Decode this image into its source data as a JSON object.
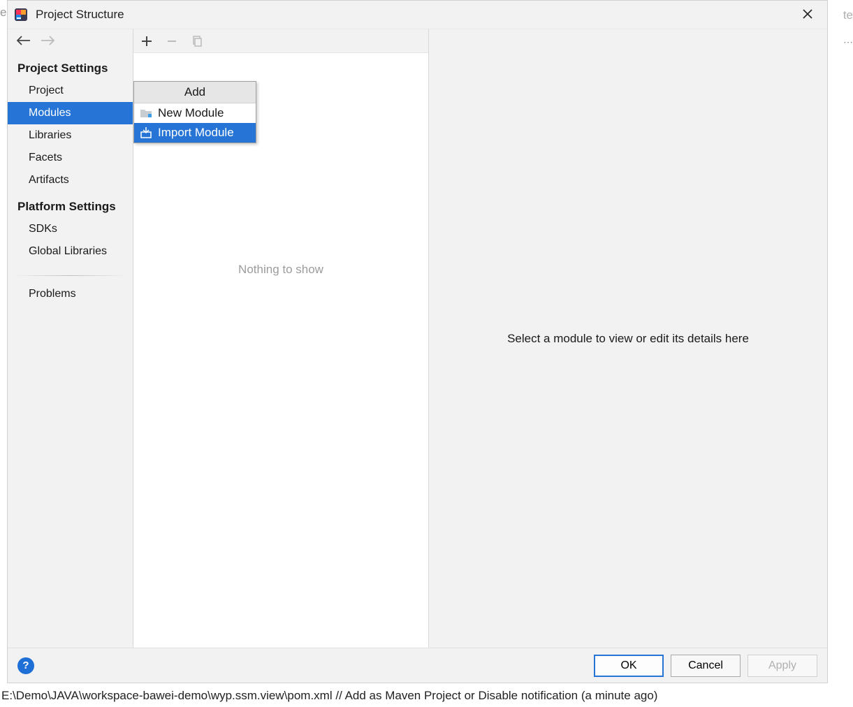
{
  "dialog": {
    "title": "Project Structure"
  },
  "sidebar": {
    "sections": [
      {
        "header": "Project Settings",
        "items": [
          "Project",
          "Modules",
          "Libraries",
          "Facets",
          "Artifacts"
        ],
        "selected_index": 1
      },
      {
        "header": "Platform Settings",
        "items": [
          "SDKs",
          "Global Libraries"
        ]
      }
    ],
    "problems_label": "Problems"
  },
  "middle": {
    "empty_text": "Nothing to show"
  },
  "right": {
    "hint": "Select a module to view or edit its details here"
  },
  "popup": {
    "title": "Add",
    "items": [
      {
        "label": "New Module",
        "icon": "folder-icon"
      },
      {
        "label": "Import Module",
        "icon": "import-icon",
        "highlighted": true
      }
    ]
  },
  "footer": {
    "ok": "OK",
    "cancel": "Cancel",
    "apply": "Apply"
  },
  "statusbar": {
    "text": "E:\\Demo\\JAVA\\workspace-bawei-demo\\wyp.ssm.view\\pom.xml // Add as Maven Project or Disable notification (a minute ago)"
  },
  "edge": {
    "left": "e",
    "right_top": "te",
    "dots": "⋯"
  }
}
